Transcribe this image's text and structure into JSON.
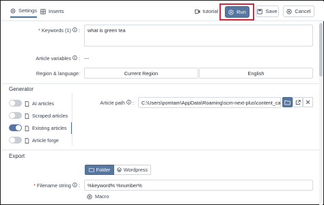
{
  "tabs": [
    {
      "label": "Settings",
      "icon": "gear-icon",
      "active": true
    },
    {
      "label": "Inserts",
      "icon": "grid-icon",
      "active": false
    }
  ],
  "toolbar": {
    "tutorial_label": "tutorial",
    "run_label": "Run",
    "save_label": "Save",
    "cancel_label": "Cancel"
  },
  "form": {
    "keywords_label": "Keywords (1)",
    "keywords_value": "what is green tea",
    "article_variables_label": "Article variables",
    "article_variables_value": "---",
    "region_language_label": "Region & language:",
    "region_value": "Current Region",
    "language_value": "English"
  },
  "generator": {
    "title": "Generator",
    "items": [
      {
        "label": "AI articles",
        "on": false
      },
      {
        "label": "Scraped articles",
        "on": false
      },
      {
        "label": "Existing articles",
        "on": true
      },
      {
        "label": "Article forge",
        "on": false
      }
    ],
    "article_path_label": "Article path",
    "article_path_value": "C:\\Users\\pomtam\\AppData\\Roaming\\scm-next-plus\\content_cache\\f"
  },
  "export": {
    "title": "Export",
    "folder_label": "Folder",
    "wordpress_label": "Wordpress",
    "filename_label": "Filename string",
    "filename_value": "%keyword% %number%",
    "macro_label": "Macro"
  },
  "colors": {
    "accent": "#5777a0",
    "highlight": "#d7263d"
  }
}
